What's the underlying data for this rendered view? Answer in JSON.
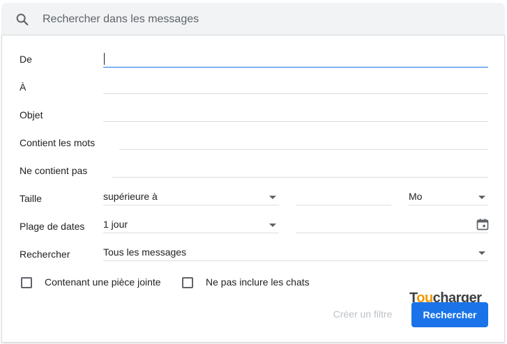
{
  "search": {
    "placeholder": "Rechercher dans les messages",
    "icon": "search-icon"
  },
  "form": {
    "from_label": "De",
    "from_value": "",
    "to_label": "À",
    "to_value": "",
    "subject_label": "Objet",
    "subject_value": "",
    "has_words_label": "Contient les mots",
    "has_words_value": "",
    "not_words_label": "Ne contient pas",
    "not_words_value": "",
    "size_label": "Taille",
    "size_operator": "supérieure à",
    "size_value": "",
    "size_unit": "Mo",
    "date_label": "Plage de dates",
    "date_range": "1 jour",
    "date_value": "",
    "search_in_label": "Rechercher",
    "search_in_value": "Tous les messages"
  },
  "checkboxes": {
    "has_attachment": {
      "label": "Contenant une pièce jointe",
      "checked": false
    },
    "exclude_chats": {
      "label": "Ne pas inclure les chats",
      "checked": false
    }
  },
  "actions": {
    "create_filter_label": "Créer un filtre",
    "search_label": "Rechercher"
  },
  "watermark": {
    "text_a": "T",
    "text_o": "ou",
    "text_b": "charger"
  },
  "colors": {
    "accent": "#1a73e8",
    "search_bg": "#f1f3f4",
    "disabled_text": "#bdc1c6",
    "divider": "#dadce0"
  }
}
